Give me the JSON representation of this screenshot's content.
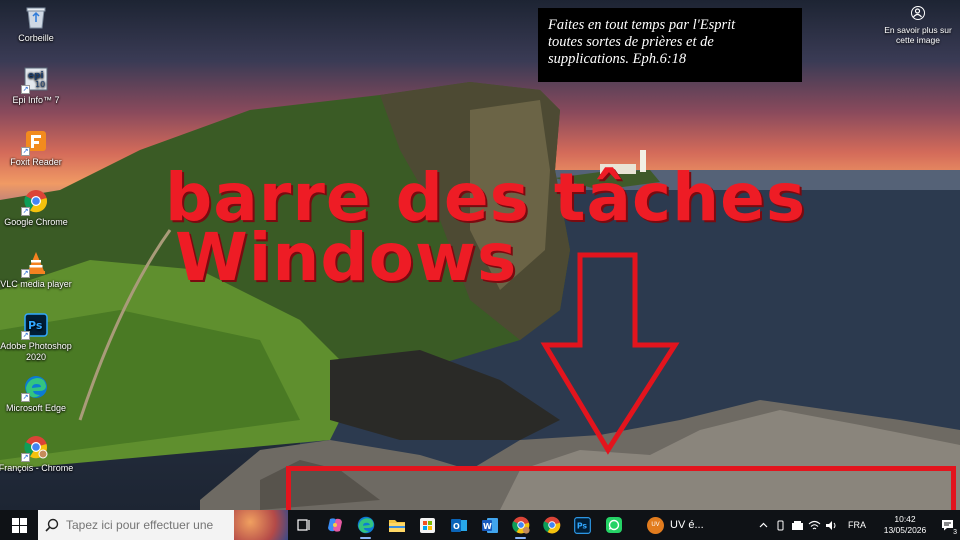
{
  "desktop": {
    "icons": [
      {
        "label": "Corbeille",
        "icon": "recycle-bin-icon"
      },
      {
        "label": "Epi Info™ 7",
        "icon": "epi-info-icon"
      },
      {
        "label": "Foxit Reader",
        "icon": "foxit-reader-icon"
      },
      {
        "label": "Google Chrome",
        "icon": "chrome-icon"
      },
      {
        "label": "VLC media player",
        "icon": "vlc-icon"
      },
      {
        "label": "Adobe Photoshop 2020",
        "icon": "photoshop-icon"
      },
      {
        "label": "Microsoft Edge",
        "icon": "edge-icon"
      },
      {
        "label": "François - Chrome",
        "icon": "chrome-profile-icon"
      }
    ],
    "verse": "Faites en tout temps par l'Esprit\ntoutes sortes de prières et de\nsupplications.   Eph.6:18",
    "learn_more": "En savoir plus sur cette image",
    "headline_line1": "barre des tâches",
    "headline_line2": "Windows"
  },
  "taskbar": {
    "search_placeholder": "Tapez ici pour effectuer une",
    "pinned": [
      {
        "icon": "task-view-icon"
      },
      {
        "icon": "copilot-icon"
      },
      {
        "icon": "edge-icon"
      },
      {
        "icon": "file-explorer-icon"
      },
      {
        "icon": "microsoft-store-icon"
      },
      {
        "icon": "outlook-icon"
      },
      {
        "icon": "word-icon"
      },
      {
        "icon": "chrome-profile-icon"
      },
      {
        "icon": "chrome-icon"
      },
      {
        "icon": "photoshop-icon"
      },
      {
        "icon": "whatsapp-icon"
      }
    ],
    "open_app_label": "UV é...",
    "open_app_badge": "UV",
    "language": "FRA",
    "time": "10:42",
    "date": "13/05/2026",
    "notification_count": "3"
  },
  "colors": {
    "headline": "#ee1c25",
    "highlight": "#e3141d",
    "taskbar": "#0f1216"
  }
}
